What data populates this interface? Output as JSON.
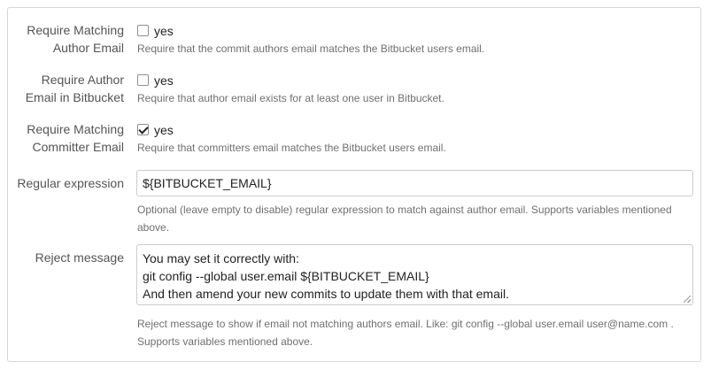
{
  "fields": [
    {
      "label_line1": "Require Matching",
      "label_line2": "Author Email",
      "checked": false,
      "checkbox_label": "yes",
      "help": "Require that the commit authors email matches the Bitbucket users email."
    },
    {
      "label_line1": "Require Author",
      "label_line2": "Email in Bitbucket",
      "checked": false,
      "checkbox_label": "yes",
      "help": "Require that author email exists for at least one user in Bitbucket."
    },
    {
      "label_line1": "Require Matching",
      "label_line2": "Committer Email",
      "checked": true,
      "checkbox_label": "yes",
      "help": "Require that committers email matches the Bitbucket users email."
    }
  ],
  "regex": {
    "label": "Regular expression",
    "value": "${BITBUCKET_EMAIL}",
    "help_line1": "Optional (leave empty to disable) regular expression to match against author email. Supports variables mentioned",
    "help_line2": "above."
  },
  "reject": {
    "label": "Reject message",
    "lines": [
      "You may set it correctly with:",
      "git config --global user.email ${BITBUCKET_EMAIL}",
      "And then amend your new commits to update them with that email."
    ],
    "help_line1": "Reject message to show if email not matching authors email. Like: git config --global user.email user@name.com .",
    "help_line2": "Supports variables mentioned above."
  }
}
